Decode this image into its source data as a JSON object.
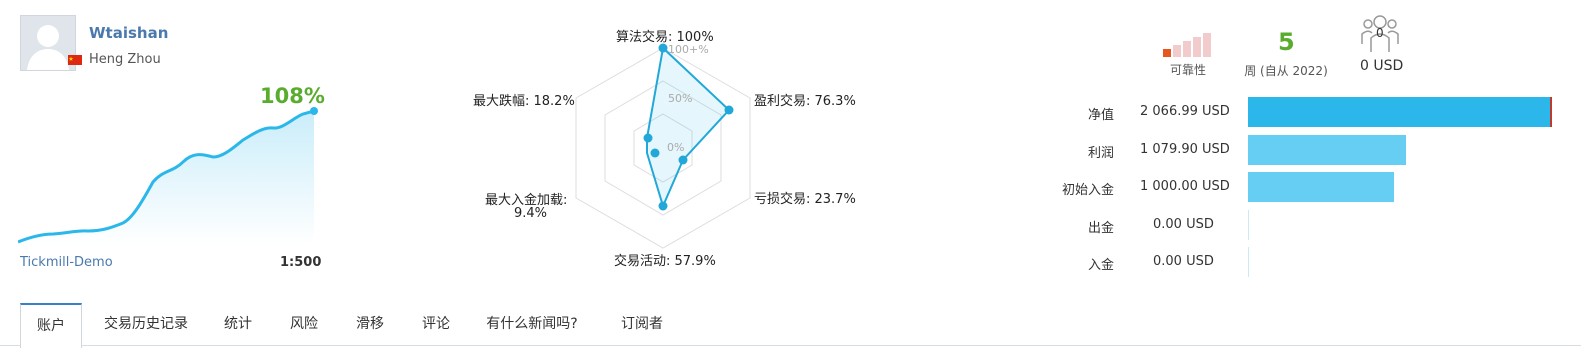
{
  "profile": {
    "name": "Wtaishan",
    "location": "Heng Zhou",
    "growth": "108%",
    "broker": "Tickmill-Demo",
    "leverage": "1:500"
  },
  "radar": {
    "algo": "算法交易: 100%",
    "profit_trades": "盈利交易: 76.3%",
    "loss_trades": "亏损交易: 23.7%",
    "activity": "交易活动: 57.9%",
    "max_deposit_load_line1": "最大入金加载:",
    "max_deposit_load_line2": "9.4%",
    "max_drawdown": "最大跌幅: 18.2%",
    "scale_top": "100+%",
    "scale_mid": "50%",
    "scale_zero": "0%"
  },
  "stats": {
    "reliability_label": "可靠性",
    "weeks_value": "5",
    "weeks_label": "周 (自从 2022)",
    "subscribers_count": "0",
    "subscribers_value": "0 USD"
  },
  "finances": {
    "rows": [
      {
        "label": "净值",
        "value": "2 066.99 USD",
        "amount": 2066.99
      },
      {
        "label": "利润",
        "value": "1 079.90 USD",
        "amount": 1079.9
      },
      {
        "label": "初始入金",
        "value": "1 000.00 USD",
        "amount": 1000.0
      },
      {
        "label": "出金",
        "value": "0.00 USD",
        "amount": 0
      },
      {
        "label": "入金",
        "value": "0.00 USD",
        "amount": 0
      }
    ]
  },
  "tabs": [
    {
      "label": "账户",
      "active": true
    },
    {
      "label": "交易历史记录"
    },
    {
      "label": "统计"
    },
    {
      "label": "风险"
    },
    {
      "label": "滑移"
    },
    {
      "label": "评论"
    },
    {
      "label": "有什么新闻吗?"
    },
    {
      "label": "订阅者"
    }
  ],
  "colors": {
    "accent_blue": "#2bb7ea",
    "light_blue": "#66cdf3",
    "green": "#5aac2e",
    "link_blue": "#4a79ad"
  }
}
